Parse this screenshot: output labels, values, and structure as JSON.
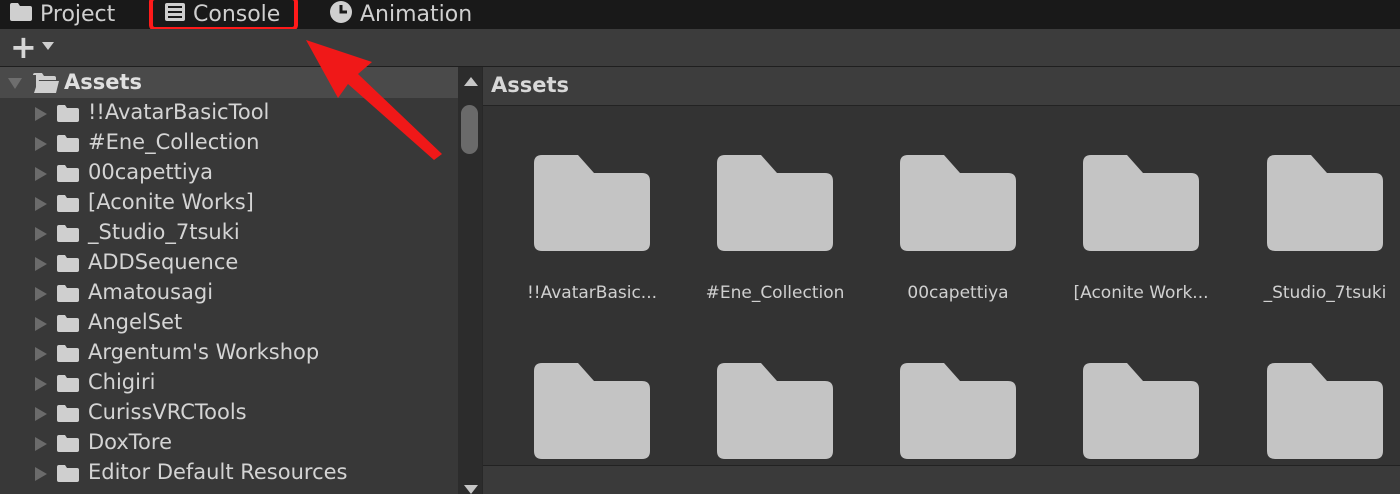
{
  "tabs": [
    {
      "label": "Project",
      "icon": "folder-icon"
    },
    {
      "label": "Console",
      "icon": "console-icon"
    },
    {
      "label": "Animation",
      "icon": "clock-icon"
    }
  ],
  "toolbar": {
    "add_label": "+"
  },
  "tree": {
    "root": "Assets",
    "items": [
      "!!AvatarBasicTool",
      "#Ene_Collection",
      "00capettiya",
      "[Aconite Works]",
      "_Studio_7tsuki",
      "ADDSequence",
      "Amatousagi",
      "AngelSet",
      "Argentum's Workshop",
      "Chigiri",
      "CurissVRCTools",
      "DoxTore",
      "Editor Default Resources"
    ]
  },
  "grid": {
    "header": "Assets",
    "items": [
      "!!AvatarBasic...",
      "#Ene_Collection",
      "00capettiya",
      "[Aconite Work...",
      "_Studio_7tsuki"
    ]
  },
  "colors": {
    "highlight": "#ff1a1a",
    "folder": "#c4c4c4"
  }
}
